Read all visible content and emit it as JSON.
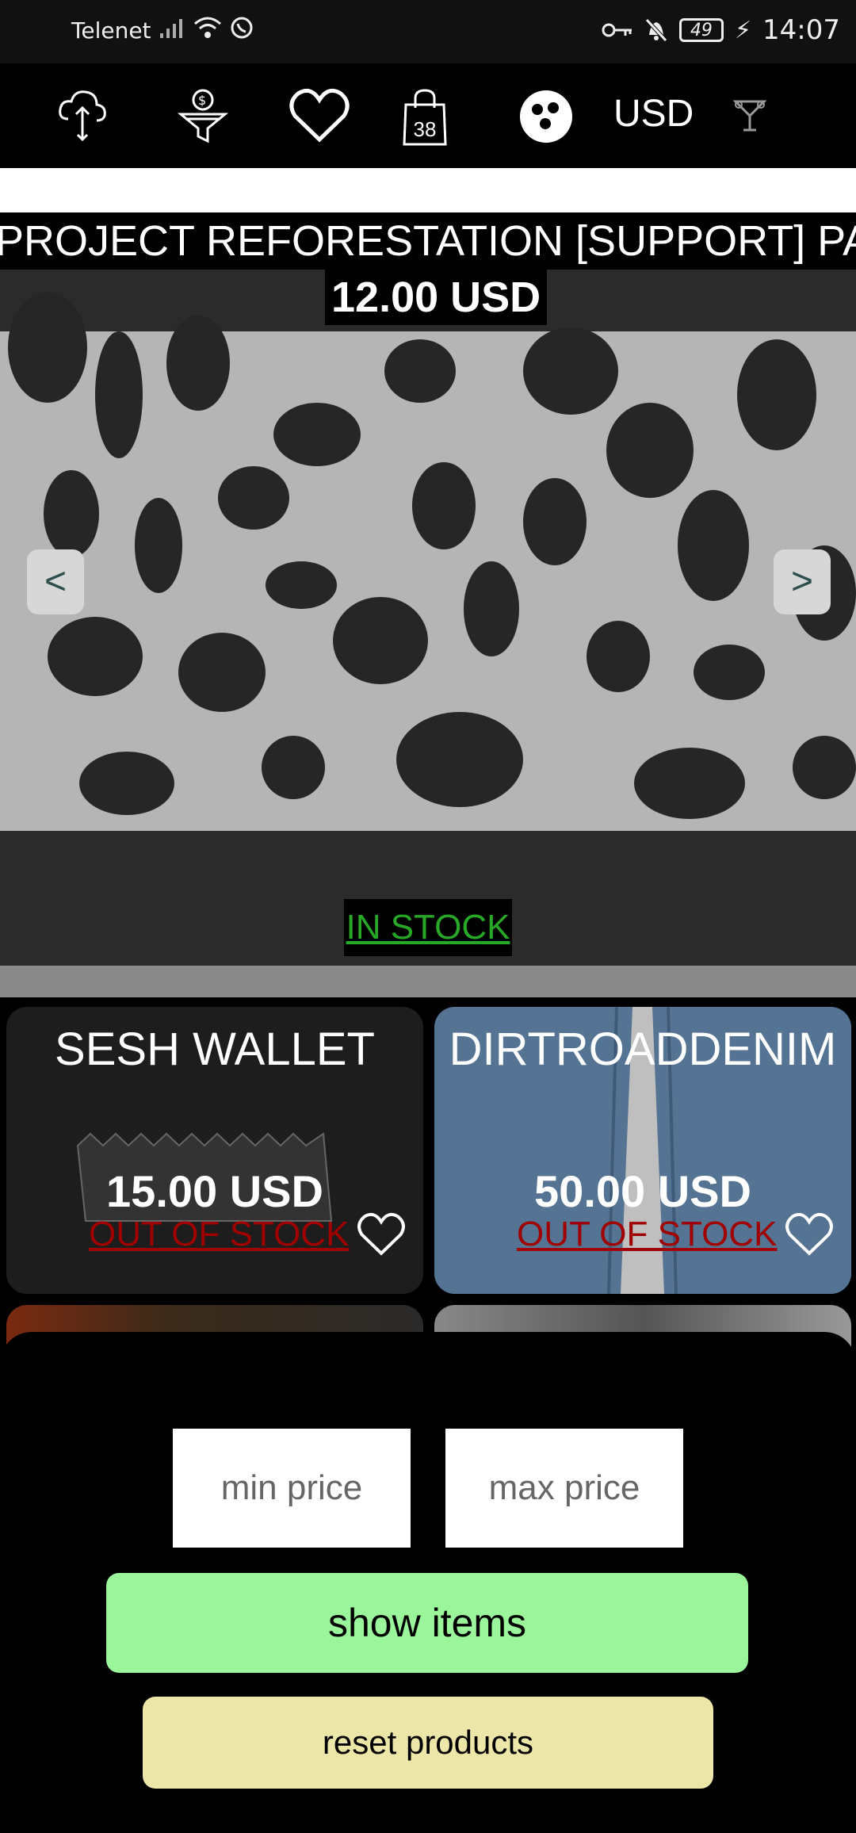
{
  "status_bar": {
    "carrier": "Telenet",
    "battery": "49",
    "time": "14:07"
  },
  "toolbar": {
    "icons": [
      "cloud-upload-icon",
      "funnel-dollar-icon",
      "heart-icon",
      "shopping-bag-icon",
      "bowling-ball-icon",
      "filter-drink-icon"
    ],
    "bag_count": "38",
    "currency": "USD"
  },
  "hero": {
    "title": "PROJECT REFORESTATION [SUPPORT] PATCH",
    "price": "12.00 USD",
    "prev_label": "<",
    "next_label": ">",
    "stock": "IN STOCK"
  },
  "products": [
    {
      "title": "SESH WALLET",
      "price": "15.00 USD",
      "stock": "OUT OF STOCK"
    },
    {
      "title": "DIRTROADDENIM",
      "price": "50.00 USD",
      "stock": "OUT OF STOCK"
    }
  ],
  "filter": {
    "min_placeholder": "min price",
    "max_placeholder": "max price",
    "show_label": "show items",
    "reset_label": "reset products"
  },
  "colors": {
    "in_stock": "#27a827",
    "out_of_stock": "#a00000",
    "show_button": "#9bf59b",
    "reset_button": "#ede6a9"
  }
}
